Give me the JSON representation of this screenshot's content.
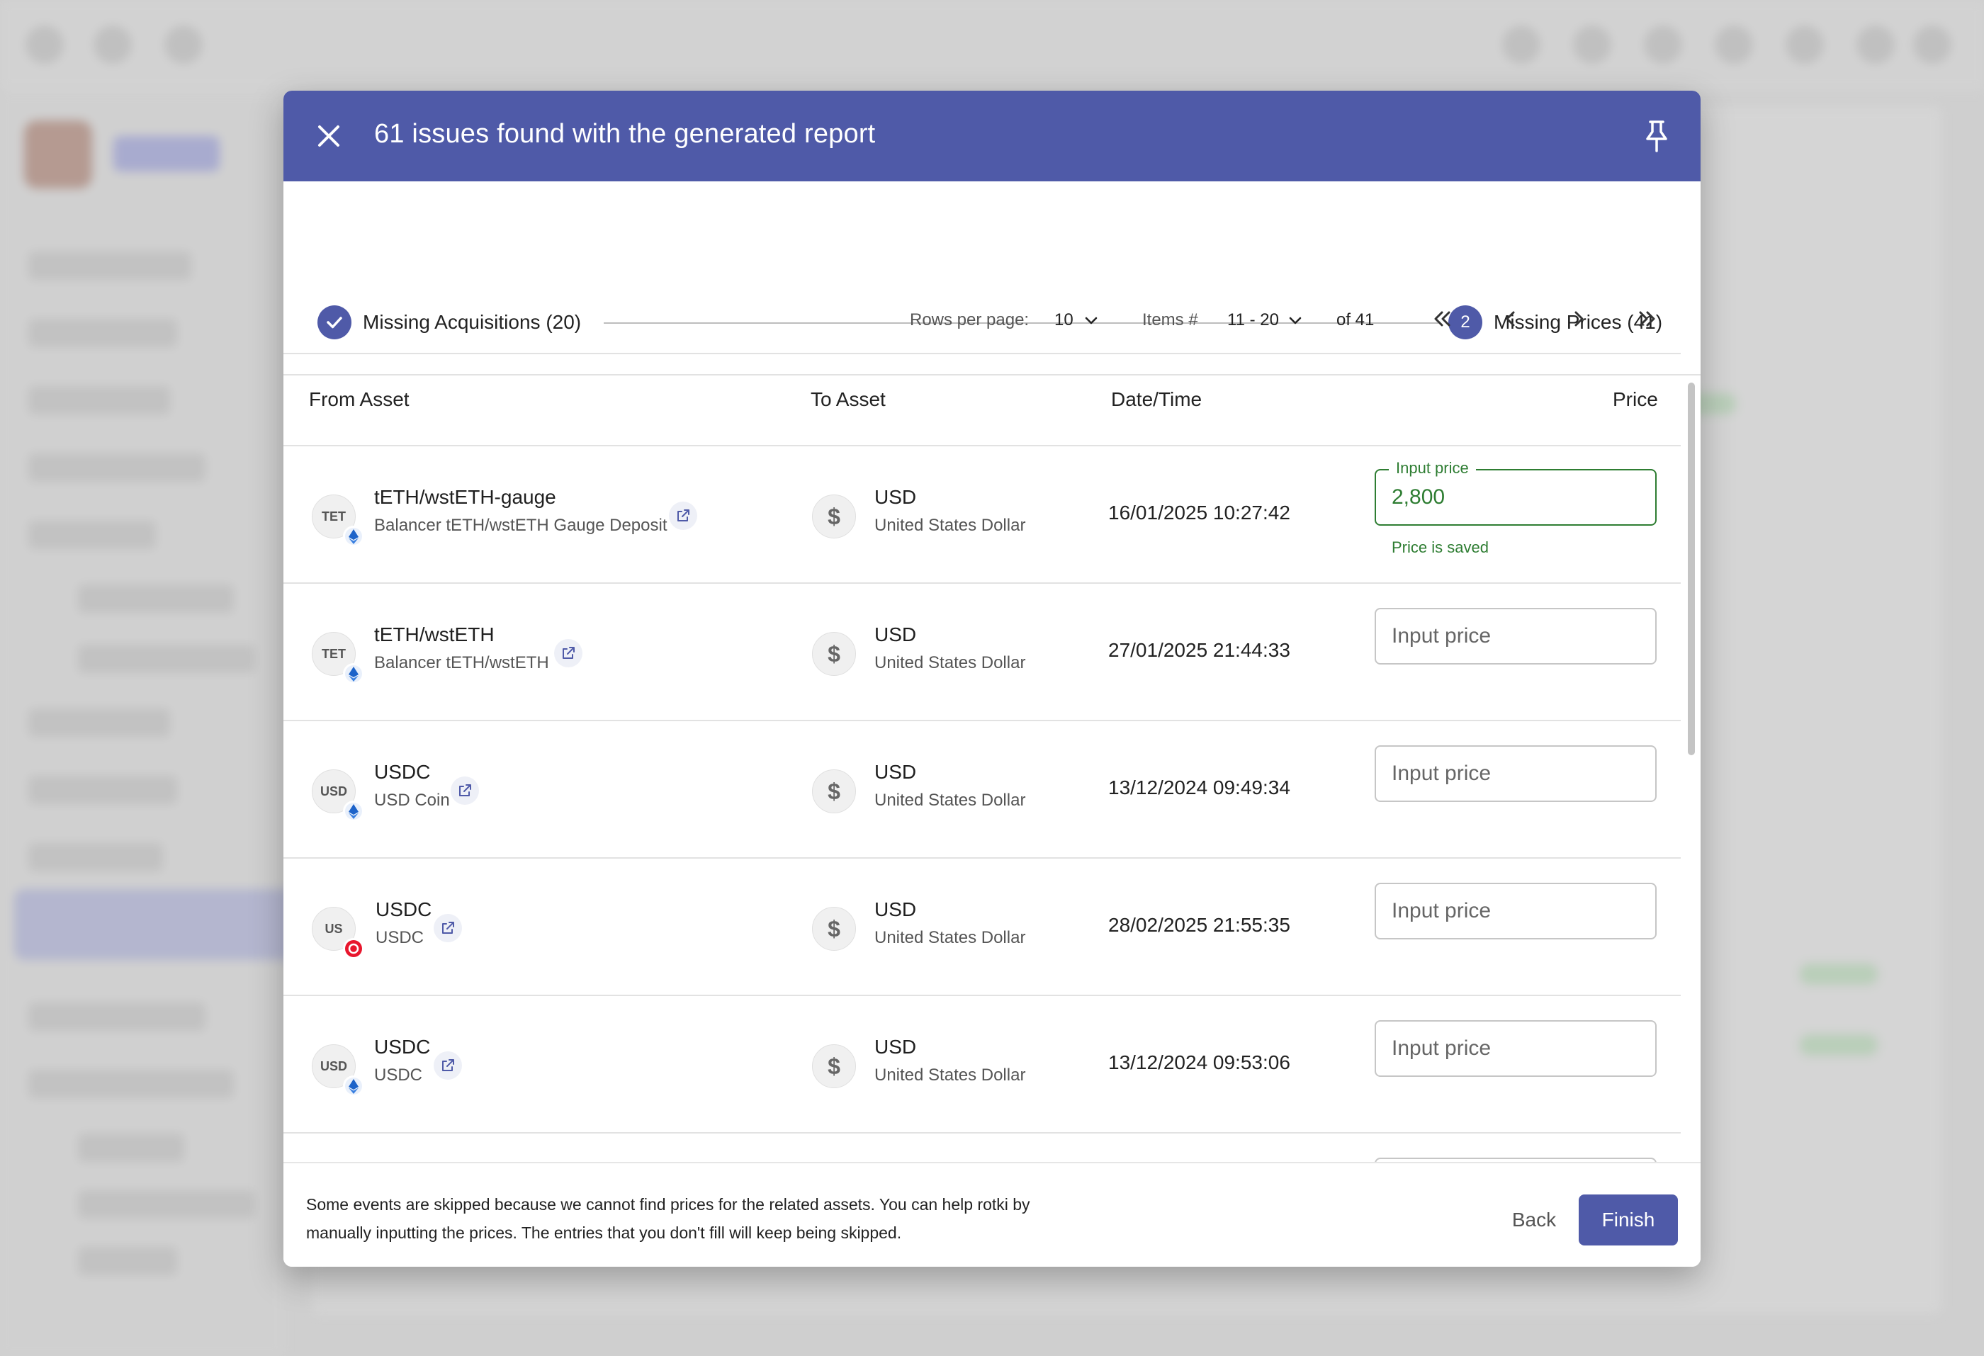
{
  "dialog": {
    "title": "61 issues found with the generated report"
  },
  "stepper": {
    "steps": [
      {
        "label": "Missing Acquisitions (20)",
        "state": "complete"
      },
      {
        "number": "2",
        "label": "Missing Prices (41)",
        "state": "active"
      }
    ]
  },
  "pagination": {
    "rows_per_page_label": "Rows per page:",
    "rows_per_page_value": "10",
    "items_label": "Items #",
    "items_range": "11 - 20",
    "total": "of 41"
  },
  "table": {
    "headers": {
      "from_asset": "From Asset",
      "to_asset": "To Asset",
      "datetime": "Date/Time",
      "price": "Price"
    },
    "input_placeholder": "Input price",
    "input_label": "Input price",
    "saved_message": "Price is saved",
    "rows": [
      {
        "avatar": "TET",
        "chain_icon": "ethereum-chain-icon",
        "symbol": "tETH/wstETH-gauge",
        "name": "Balancer tETH/wstETH Gauge Deposit",
        "to_icon": "dollar-icon",
        "to_symbol": "USD",
        "to_name": "United States Dollar",
        "datetime": "16/01/2025 10:27:42",
        "price": "2,800"
      },
      {
        "avatar": "TET",
        "chain_icon": "ethereum-chain-icon",
        "symbol": "tETH/wstETH",
        "name": "Balancer tETH/wstETH",
        "to_icon": "dollar-icon",
        "to_symbol": "USD",
        "to_name": "United States Dollar",
        "datetime": "27/01/2025 21:44:33",
        "price": ""
      },
      {
        "avatar": "USD",
        "chain_icon": "ethereum-chain-icon",
        "symbol": "USDC",
        "name": "USD Coin",
        "to_icon": "dollar-icon",
        "to_symbol": "USD",
        "to_name": "United States Dollar",
        "datetime": "13/12/2024 09:49:34",
        "price": ""
      },
      {
        "avatar": "US",
        "chain_icon": "optimism-chain-icon",
        "symbol": "USDC",
        "name": "USDC",
        "to_icon": "dollar-icon",
        "to_symbol": "USD",
        "to_name": "United States Dollar",
        "datetime": "28/02/2025 21:55:35",
        "price": ""
      },
      {
        "avatar": "USD",
        "chain_icon": "ethereum-chain-icon",
        "symbol": "USDC",
        "name": "USDC",
        "to_icon": "dollar-icon",
        "to_symbol": "USD",
        "to_name": "United States Dollar",
        "datetime": "13/12/2024 09:53:06",
        "price": ""
      }
    ]
  },
  "footer": {
    "message": "Some events are skipped because we cannot find prices for the related assets. You can help rotki by manually inputting the prices. The entries that you don't fill will keep being skipped.",
    "back_label": "Back",
    "finish_label": "Finish"
  },
  "colors": {
    "primary": "#4f5aa8",
    "success": "#2e7d32",
    "optimism_red": "#e8162d"
  }
}
